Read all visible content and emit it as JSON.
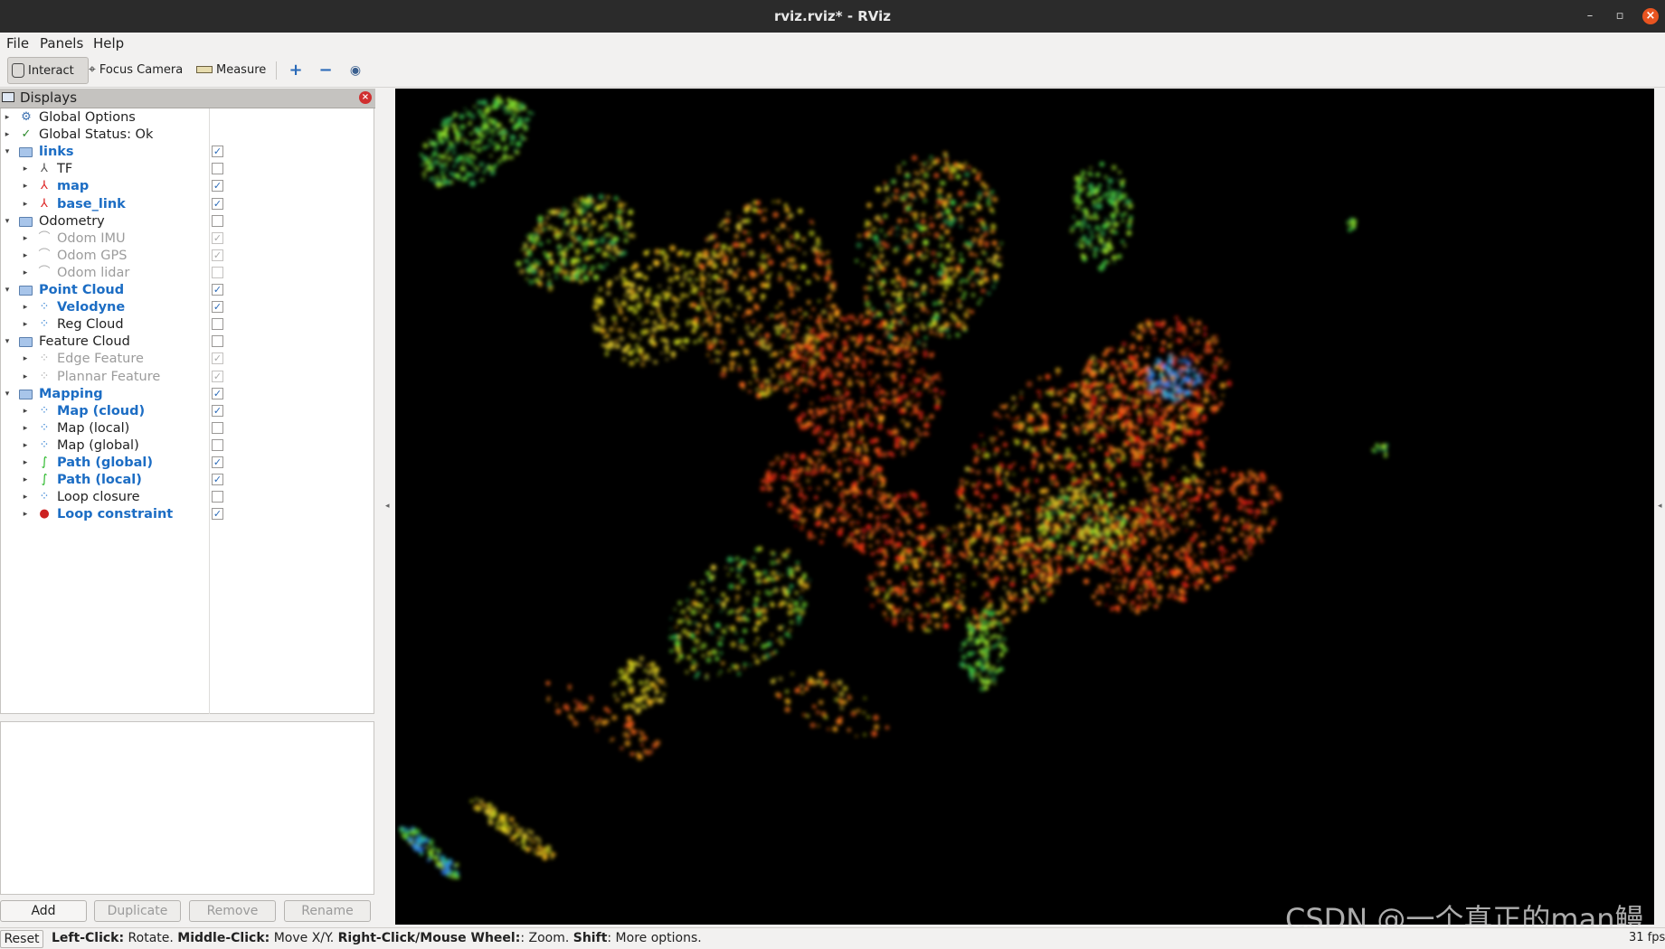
{
  "window": {
    "title": "rviz.rviz* - RViz"
  },
  "menu": [
    "File",
    "Panels",
    "Help"
  ],
  "toolbar": {
    "interact": "Interact",
    "focus_camera": "Focus Camera",
    "measure": "Measure"
  },
  "displays": {
    "title": "Displays",
    "rows": [
      {
        "label": "Global Options",
        "level": 0,
        "expanded": false,
        "icon": "gear-icon",
        "style": "normal",
        "checkbox": null
      },
      {
        "label": "Global Status: Ok",
        "level": 0,
        "expanded": false,
        "icon": "check-icon",
        "style": "normal",
        "checkbox": null
      },
      {
        "label": "links",
        "level": 0,
        "expanded": true,
        "icon": "folder-icon",
        "style": "bold",
        "checkbox": "checked"
      },
      {
        "label": "TF",
        "level": 1,
        "expanded": false,
        "icon": "tf-icon",
        "style": "normal",
        "checkbox": "unchecked"
      },
      {
        "label": "map",
        "level": 1,
        "expanded": false,
        "icon": "axes-icon",
        "style": "bold",
        "checkbox": "checked"
      },
      {
        "label": "base_link",
        "level": 1,
        "expanded": false,
        "icon": "axes-icon",
        "style": "bold",
        "checkbox": "checked"
      },
      {
        "label": "Odometry",
        "level": 0,
        "expanded": true,
        "icon": "folder-icon",
        "style": "normal",
        "checkbox": "unchecked"
      },
      {
        "label": "Odom IMU",
        "level": 1,
        "expanded": false,
        "icon": "odometry-icon",
        "style": "dim",
        "checkbox": "checked-dim"
      },
      {
        "label": "Odom GPS",
        "level": 1,
        "expanded": false,
        "icon": "odometry-icon",
        "style": "dim",
        "checkbox": "checked-dim"
      },
      {
        "label": "Odom lidar",
        "level": 1,
        "expanded": false,
        "icon": "odometry-icon",
        "style": "dim",
        "checkbox": "unchecked-dim"
      },
      {
        "label": "Point Cloud",
        "level": 0,
        "expanded": true,
        "icon": "folder-icon",
        "style": "bold",
        "checkbox": "checked"
      },
      {
        "label": "Velodyne",
        "level": 1,
        "expanded": false,
        "icon": "pointcloud-icon",
        "style": "bold",
        "checkbox": "checked"
      },
      {
        "label": "Reg Cloud",
        "level": 1,
        "expanded": false,
        "icon": "pointcloud-icon",
        "style": "normal",
        "checkbox": "unchecked"
      },
      {
        "label": "Feature Cloud",
        "level": 0,
        "expanded": true,
        "icon": "folder-icon",
        "style": "normal",
        "checkbox": "unchecked"
      },
      {
        "label": "Edge Feature",
        "level": 1,
        "expanded": false,
        "icon": "pointcloud-icon",
        "style": "dim",
        "checkbox": "checked-dim"
      },
      {
        "label": "Plannar Feature",
        "level": 1,
        "expanded": false,
        "icon": "pointcloud-icon",
        "style": "dim",
        "checkbox": "checked-dim"
      },
      {
        "label": "Mapping",
        "level": 0,
        "expanded": true,
        "icon": "folder-icon",
        "style": "bold",
        "checkbox": "checked"
      },
      {
        "label": "Map (cloud)",
        "level": 1,
        "expanded": false,
        "icon": "pointcloud-icon",
        "style": "bold",
        "checkbox": "checked"
      },
      {
        "label": "Map (local)",
        "level": 1,
        "expanded": false,
        "icon": "pointcloud-icon",
        "style": "normal",
        "checkbox": "unchecked"
      },
      {
        "label": "Map (global)",
        "level": 1,
        "expanded": false,
        "icon": "pointcloud-icon",
        "style": "normal",
        "checkbox": "unchecked"
      },
      {
        "label": "Path (global)",
        "level": 1,
        "expanded": false,
        "icon": "path-icon",
        "style": "bold",
        "checkbox": "checked"
      },
      {
        "label": "Path (local)",
        "level": 1,
        "expanded": false,
        "icon": "path-icon",
        "style": "bold",
        "checkbox": "checked"
      },
      {
        "label": "Loop closure",
        "level": 1,
        "expanded": false,
        "icon": "pointcloud-icon",
        "style": "normal",
        "checkbox": "unchecked"
      },
      {
        "label": "Loop constraint",
        "level": 1,
        "expanded": false,
        "icon": "marker-icon",
        "style": "bold",
        "checkbox": "checked"
      }
    ],
    "buttons": {
      "add": "Add",
      "duplicate": "Duplicate",
      "remove": "Remove",
      "rename": "Rename"
    }
  },
  "status": {
    "reset": "Reset",
    "segments": [
      {
        "b": "Left-Click:",
        "t": " Rotate. "
      },
      {
        "b": "Middle-Click:",
        "t": " Move X/Y. "
      },
      {
        "b": "Right-Click/Mouse Wheel:",
        "t": ": Zoom. "
      },
      {
        "b": "Shift",
        "t": ": More options."
      }
    ],
    "fps": "31 fps"
  },
  "watermark": "CSDN @一个真正的man鳗",
  "colors": {
    "accent": "#1c6dc4",
    "render_bg": "#000000",
    "titlebar": "#2b2b2b",
    "close": "#e95420"
  }
}
